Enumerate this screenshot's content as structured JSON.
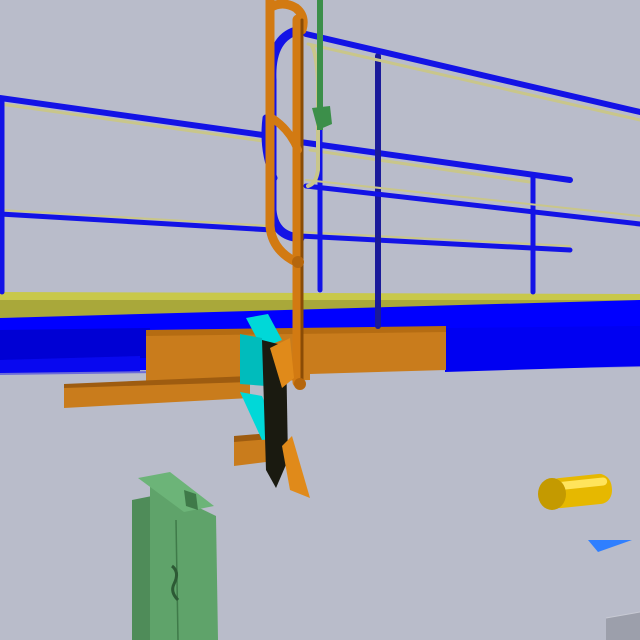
{
  "scene": {
    "colors": {
      "background": "#b9bcca",
      "railing": "#1313e6",
      "railing_highlight": "#5c5cff",
      "guard_rail": "#c9c68a",
      "deck": "#0000ff",
      "deck_edge": "#c8c84a",
      "pipe": "#d27a12",
      "pipe_dark": "#8a4c06",
      "beam": "#c97c1c",
      "beam_shadow": "#9e5c10",
      "bracket": "#00d8d8",
      "cabinet": "#5fa36a",
      "cabinet_dark": "#3f7a49",
      "cylinder": "#e6b800",
      "pole_green": "#3c8f4a",
      "marker": "#2f7fff",
      "floor_block": "#9c9fab"
    },
    "objects": [
      "platform-deck",
      "guard-railing",
      "vertical-pipe",
      "steel-beam",
      "support-bracket",
      "control-cabinet",
      "gas-cylinder",
      "direction-marker",
      "floor-block"
    ]
  }
}
